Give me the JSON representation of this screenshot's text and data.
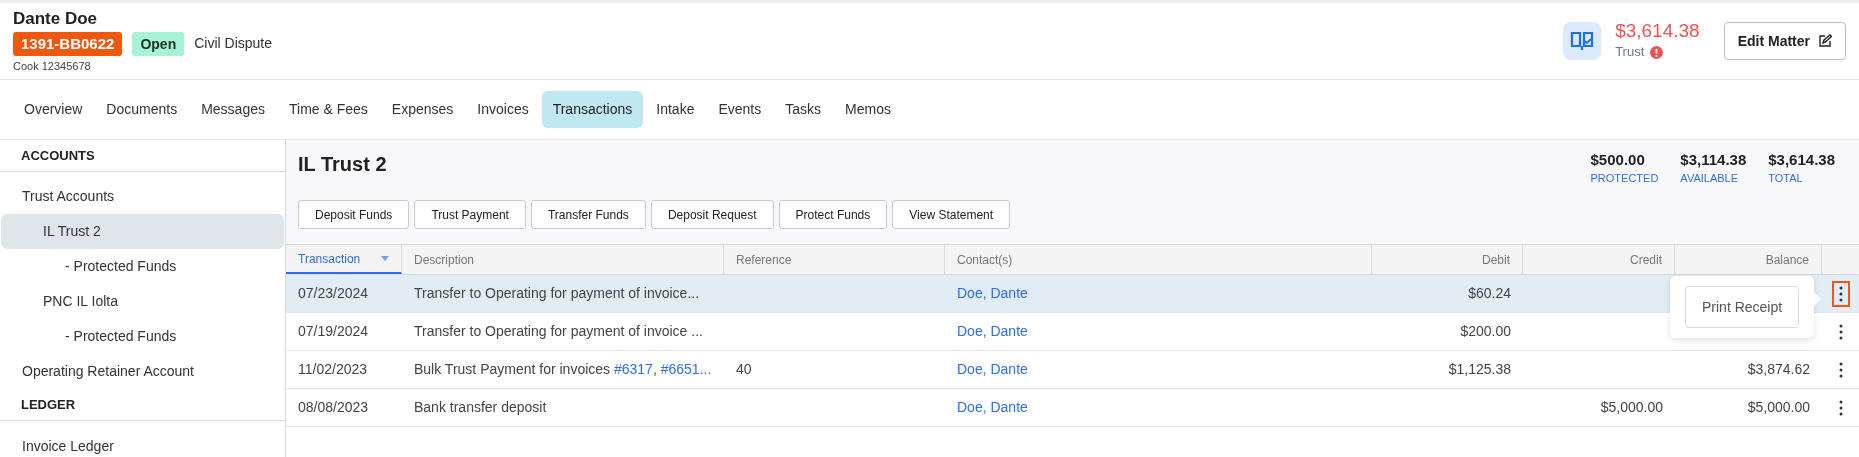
{
  "matter": {
    "name": "Dante Doe",
    "number": "1391-BB0622",
    "status": "Open",
    "type": "Civil Dispute",
    "subtitle": "Cook 12345678"
  },
  "trust_summary": {
    "amount": "$3,614.38",
    "label": "Trust",
    "warning": true
  },
  "edit_button": "Edit Matter",
  "tabs": [
    {
      "label": "Overview",
      "selected": false
    },
    {
      "label": "Documents",
      "selected": false
    },
    {
      "label": "Messages",
      "selected": false
    },
    {
      "label": "Time & Fees",
      "selected": false
    },
    {
      "label": "Expenses",
      "selected": false
    },
    {
      "label": "Invoices",
      "selected": false
    },
    {
      "label": "Transactions",
      "selected": true
    },
    {
      "label": "Intake",
      "selected": false
    },
    {
      "label": "Events",
      "selected": false
    },
    {
      "label": "Tasks",
      "selected": false
    },
    {
      "label": "Memos",
      "selected": false
    }
  ],
  "sidebar": {
    "sections": [
      {
        "heading": "ACCOUNTS",
        "items": [
          {
            "label": "Trust Accounts",
            "selected": false,
            "children": [
              {
                "label": "IL Trust 2",
                "selected": true,
                "children": [
                  {
                    "label": "- Protected Funds",
                    "selected": false
                  }
                ]
              },
              {
                "label": "PNC IL Iolta",
                "selected": false,
                "children": [
                  {
                    "label": "- Protected Funds",
                    "selected": false
                  }
                ]
              }
            ]
          },
          {
            "label": "Operating Retainer Account",
            "selected": false
          }
        ]
      },
      {
        "heading": "LEDGER",
        "items": [
          {
            "label": "Invoice Ledger",
            "selected": false
          }
        ]
      }
    ]
  },
  "account": {
    "title": "IL Trust 2",
    "totals": [
      {
        "amount": "$500.00",
        "label": "PROTECTED"
      },
      {
        "amount": "$3,114.38",
        "label": "AVAILABLE"
      },
      {
        "amount": "$3,614.38",
        "label": "TOTAL"
      }
    ],
    "actions": [
      "Deposit Funds",
      "Trust Payment",
      "Transfer Funds",
      "Deposit Request",
      "Protect Funds",
      "View Statement"
    ]
  },
  "table": {
    "columns": [
      {
        "label": "Transaction",
        "sorted": true
      },
      {
        "label": "Description",
        "sorted": false
      },
      {
        "label": "Reference",
        "sorted": false
      },
      {
        "label": "Contact(s)",
        "sorted": false
      },
      {
        "label": "Debit",
        "sorted": false
      },
      {
        "label": "Credit",
        "sorted": false
      },
      {
        "label": "Balance",
        "sorted": false
      }
    ],
    "rows": [
      {
        "selected": true,
        "date": "07/23/2024",
        "description": [
          {
            "kind": "text",
            "text": "Transfer to Operating for payment of invoice..."
          }
        ],
        "contact": "Doe, Dante",
        "debit": "$60.24"
      },
      {
        "selected": false,
        "date": "07/19/2024",
        "description": [
          {
            "kind": "text",
            "text": "Transfer to Operating for payment of invoice ..."
          }
        ],
        "contact": "Doe, Dante",
        "debit": "$200.00"
      },
      {
        "selected": false,
        "date": "11/02/2023",
        "description": [
          {
            "kind": "text",
            "text": "Bulk Trust Payment for invoices "
          },
          {
            "kind": "link",
            "text": "#6317"
          },
          {
            "kind": "text",
            "text": ", "
          },
          {
            "kind": "link",
            "text": "#6651..."
          }
        ],
        "reference": "40",
        "contact": "Doe, Dante",
        "debit": "$1,125.38",
        "balance": "$3,874.62"
      },
      {
        "selected": false,
        "date": "08/08/2023",
        "description": [
          {
            "kind": "text",
            "text": "Bank transfer deposit"
          }
        ],
        "contact": "Doe, Dante",
        "credit": "$5,000.00",
        "balance": "$5,000.00"
      }
    ]
  },
  "row_menu": {
    "items": [
      "Print Receipt"
    ]
  }
}
